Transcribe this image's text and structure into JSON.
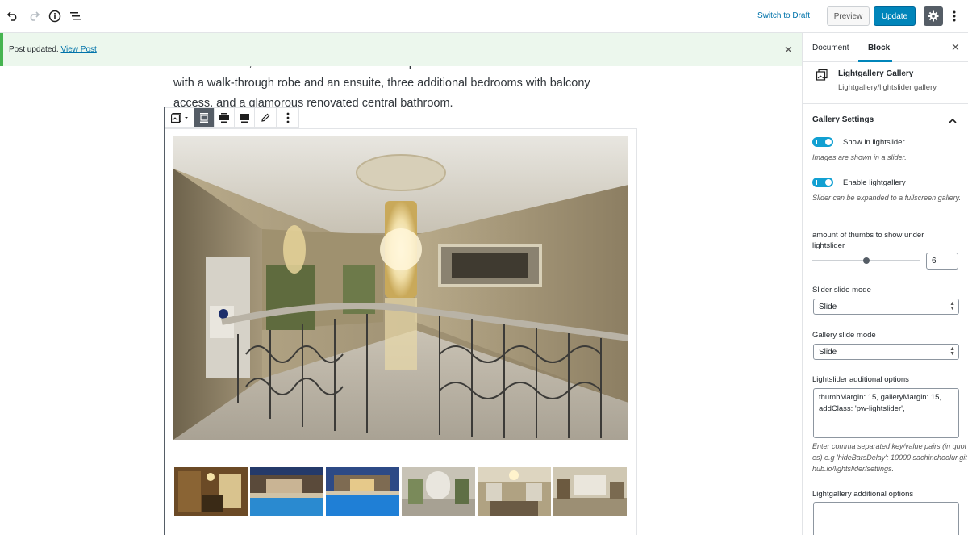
{
  "toolbar": {
    "undo_icon": "undo-icon",
    "redo_icon": "redo-icon",
    "info_icon": "info-icon",
    "outline_icon": "list-icon",
    "switch_to_draft": "Switch to Draft",
    "preview": "Preview",
    "update": "Update",
    "settings_icon": "gear-icon",
    "more_icon": "vertical-ellipsis-icon"
  },
  "notice": {
    "text": "Post updated.",
    "link": "View Post"
  },
  "content": {
    "paragraph": "barbecue area, a terrace and a bathroom. A spiral staircase leads to the main bedroom with a walk-through robe and an ensuite, three additional bedrooms with balcony access, and a glamorous renovated central bathroom."
  },
  "sidebar": {
    "tabs": [
      "Document",
      "Block"
    ],
    "active_tab": "Block",
    "block": {
      "title": "Lightgallery Gallery",
      "description": "Lightgallery/lightslider gallery."
    },
    "panel_title": "Gallery Settings",
    "show_lightslider": {
      "label": "Show in lightslider",
      "help": "Images are shown in a slider.",
      "checked": true
    },
    "enable_lightgallery": {
      "label": "Enable lightgallery",
      "help": "Slider can be expanded to a fullscreen gallery.",
      "checked": true
    },
    "thumbs": {
      "label": "amount of thumbs to show under lightslider",
      "value": "6"
    },
    "slider_slide_mode": {
      "label": "Slider slide mode",
      "value": "Slide"
    },
    "gallery_slide_mode": {
      "label": "Gallery slide mode",
      "value": "Slide"
    },
    "lightslider_options": {
      "label": "Lightslider additional options",
      "value": "thumbMargin: 15, galleryMargin: 15, addClass: 'pw-lightslider',",
      "help": "Enter comma separated key/value pairs (in quotes) e.g 'hideBarsDelay': 10000 sachinchoolur.github.io/lightslider/settings."
    },
    "lightgallery_options": {
      "label": "Lightgallery additional options",
      "value": ""
    }
  },
  "colors": {
    "accent": "#0085ba",
    "toggle": "#11a0d2",
    "notice_bg": "#ecf7ed",
    "notice_border": "#46b450"
  }
}
